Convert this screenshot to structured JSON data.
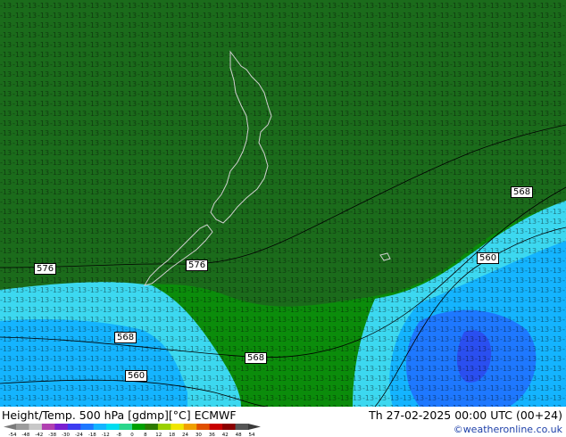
{
  "title_left": "Height/Temp. 500 hPa [gdmp][°C] ECMWF",
  "title_right": "Th 27-02-2025 00:00 UTC (00+24)",
  "credit": "©weatheronline.co.uk",
  "height_contour_labels": [
    "576",
    "576",
    "568",
    "568",
    "560",
    "568",
    "560"
  ],
  "colorbar": {
    "ticks": [
      "-54",
      "-48",
      "-42",
      "-38",
      "-30",
      "-24",
      "-18",
      "-12",
      "-8",
      "0",
      "8",
      "12",
      "18",
      "24",
      "30",
      "36",
      "42",
      "48",
      "54"
    ],
    "colors": [
      "#9c9c9c",
      "#c8c8c8",
      "#b040b0",
      "#7a1fd0",
      "#3c3cf0",
      "#1e78ff",
      "#14b4ff",
      "#00dcf0",
      "#2ad68c",
      "#00a000",
      "#2c7a00",
      "#9ad000",
      "#f0e600",
      "#f0a000",
      "#e05000",
      "#c80000",
      "#8a0000",
      "#555555"
    ]
  },
  "colors": {
    "dark_green": "#1b6b1b",
    "mid_green": "#0b8c0b",
    "light_cyan": "#3cd8f0",
    "mid_cyan": "#14b4ff",
    "blue": "#1e78ff",
    "deep_blue": "#2a4ff0"
  }
}
